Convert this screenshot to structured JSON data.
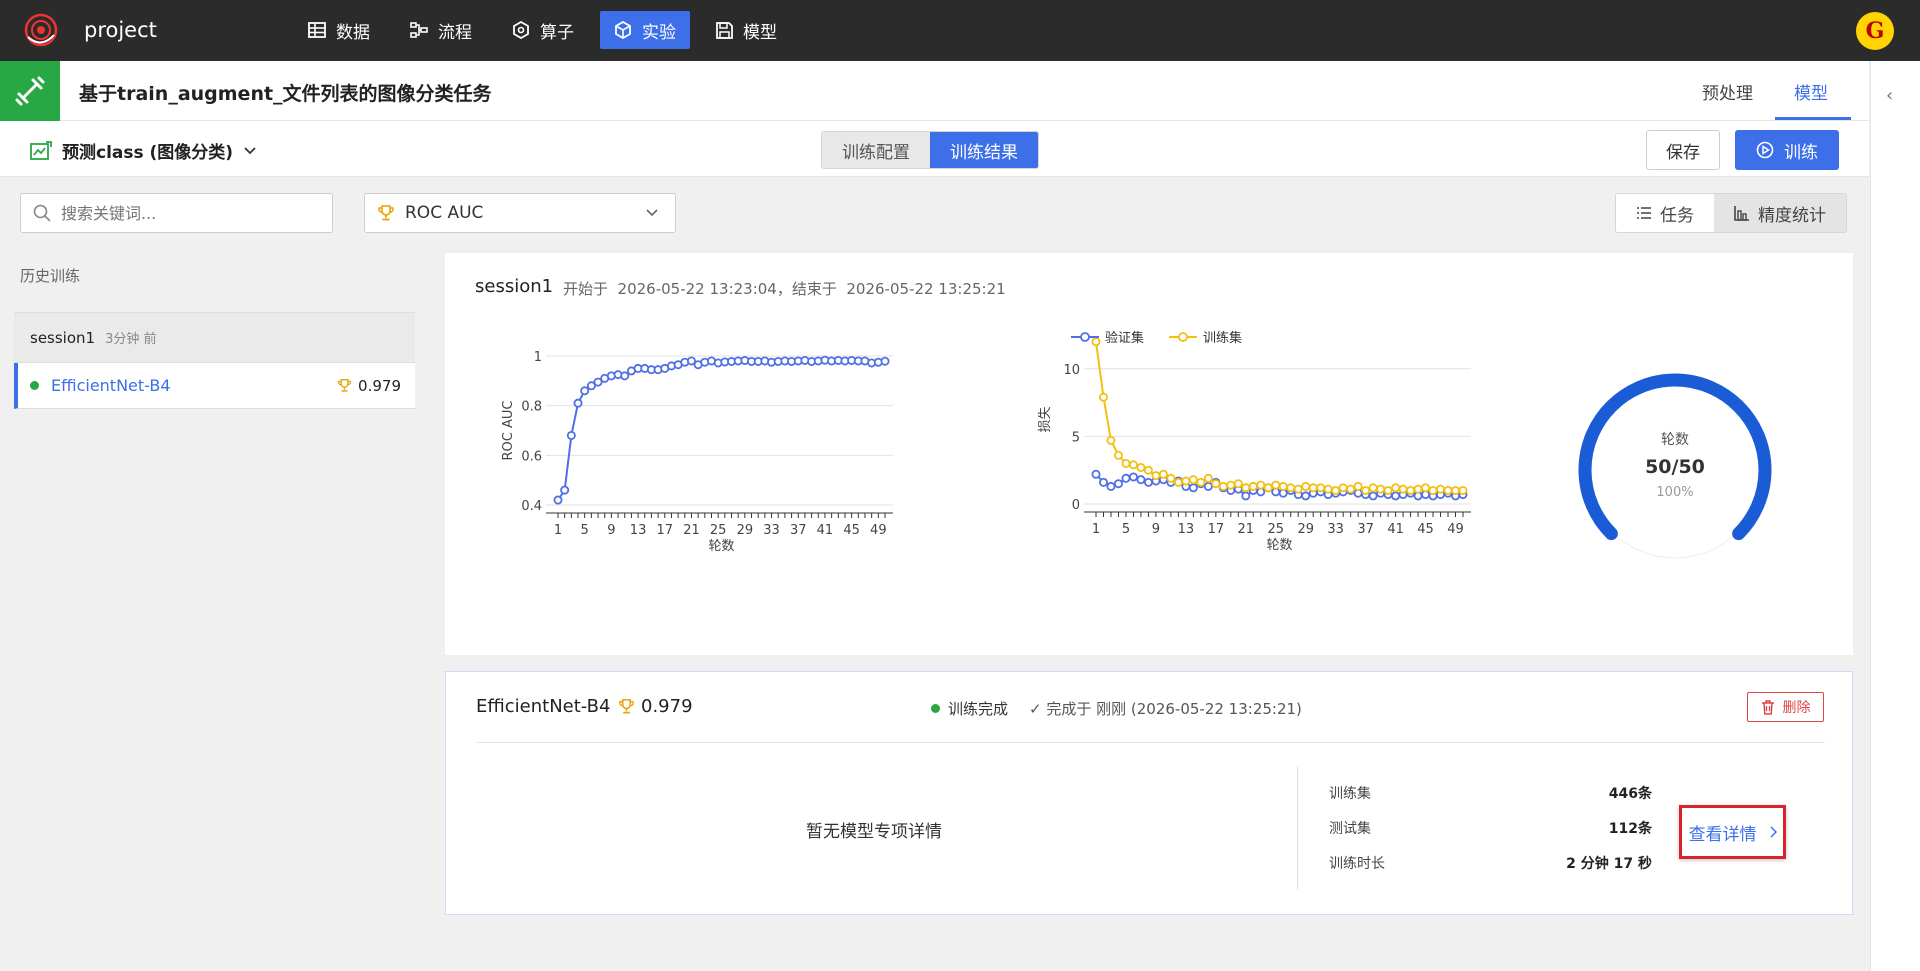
{
  "app": {
    "project_name": "project",
    "avatar_letter": "G",
    "nav": [
      {
        "label": "数据",
        "icon": "table-icon"
      },
      {
        "label": "流程",
        "icon": "flow-icon"
      },
      {
        "label": "算子",
        "icon": "operator-icon"
      },
      {
        "label": "实验",
        "icon": "cube-icon",
        "active": true
      },
      {
        "label": "模型",
        "icon": "save-icon"
      }
    ]
  },
  "header": {
    "title": "基于train_augment_文件列表的图像分类任务",
    "tabs": [
      "预处理",
      "模型"
    ],
    "active_tab": "模型"
  },
  "toolbar": {
    "prediction": "预测class (图像分类)",
    "segments": [
      "训练配置",
      "训练结果"
    ],
    "active_segment": "训练结果",
    "save_label": "保存",
    "train_label": "训练"
  },
  "filters": {
    "search_placeholder": "搜索关键词...",
    "metric": "ROC AUC",
    "view_tabs": [
      "任务",
      "精度统计"
    ],
    "active_view": "任务"
  },
  "history": {
    "label": "历史训练",
    "session_name": "session1",
    "session_time": "3分钟 前",
    "model_name": "EfficientNet-B4",
    "model_score": "0.979"
  },
  "session": {
    "name": "session1",
    "time_text": "开始于  2026-05-22 13:23:04，结束于  2026-05-22 13:25:21"
  },
  "chart_data": [
    {
      "type": "line",
      "xlabel": "轮数",
      "ylabel": "ROC AUC",
      "ylim": [
        0.4,
        1
      ],
      "yticks": [
        "0.4",
        "0.6",
        "0.8",
        "1"
      ],
      "xticks": [
        "1",
        "5",
        "9",
        "13",
        "17",
        "21",
        "25",
        "29",
        "33",
        "37",
        "41",
        "45",
        "49"
      ],
      "x": [
        1,
        2,
        3,
        4,
        5,
        6,
        7,
        8,
        9,
        10,
        11,
        12,
        13,
        14,
        15,
        16,
        17,
        18,
        19,
        20,
        21,
        22,
        23,
        24,
        25,
        26,
        27,
        28,
        29,
        30,
        31,
        32,
        33,
        34,
        35,
        36,
        37,
        38,
        39,
        40,
        41,
        42,
        43,
        44,
        45,
        46,
        47,
        48,
        49,
        50
      ],
      "series": [
        {
          "color": "#4f6fe6",
          "values": [
            0.42,
            0.46,
            0.68,
            0.81,
            0.86,
            0.88,
            0.895,
            0.91,
            0.92,
            0.925,
            0.92,
            0.94,
            0.95,
            0.95,
            0.945,
            0.945,
            0.95,
            0.96,
            0.965,
            0.975,
            0.98,
            0.965,
            0.975,
            0.98,
            0.972,
            0.976,
            0.978,
            0.98,
            0.982,
            0.978,
            0.978,
            0.98,
            0.975,
            0.978,
            0.98,
            0.978,
            0.98,
            0.982,
            0.978,
            0.98,
            0.983,
            0.98,
            0.982,
            0.98,
            0.982,
            0.98,
            0.98,
            0.972,
            0.975,
            0.979
          ]
        }
      ]
    },
    {
      "type": "line",
      "xlabel": "轮数",
      "ylabel": "损失",
      "ylim": [
        0,
        12.5
      ],
      "yticks": [
        "0",
        "5",
        "10"
      ],
      "xticks": [
        "1",
        "5",
        "9",
        "13",
        "17",
        "21",
        "25",
        "29",
        "33",
        "37",
        "41",
        "45",
        "49"
      ],
      "legend": "top",
      "x": [
        1,
        2,
        3,
        4,
        5,
        6,
        7,
        8,
        9,
        10,
        11,
        12,
        13,
        14,
        15,
        16,
        17,
        18,
        19,
        20,
        21,
        22,
        23,
        24,
        25,
        26,
        27,
        28,
        29,
        30,
        31,
        32,
        33,
        34,
        35,
        36,
        37,
        38,
        39,
        40,
        41,
        42,
        43,
        44,
        45,
        46,
        47,
        48,
        49,
        50
      ],
      "series": [
        {
          "name": "验证集",
          "color": "#4f6fe6",
          "values": [
            2.2,
            1.6,
            1.3,
            1.5,
            1.9,
            2.0,
            1.8,
            1.6,
            1.7,
            1.8,
            1.6,
            1.7,
            1.3,
            1.2,
            1.5,
            1.3,
            1.6,
            1.2,
            1.0,
            1.1,
            0.6,
            1.0,
            0.9,
            1.2,
            0.9,
            0.8,
            1.0,
            0.7,
            0.6,
            0.8,
            0.9,
            0.7,
            0.8,
            0.9,
            1.0,
            0.8,
            0.7,
            0.6,
            0.8,
            0.7,
            0.6,
            0.7,
            0.8,
            0.6,
            0.7,
            0.6,
            0.7,
            0.8,
            0.6,
            0.7
          ]
        },
        {
          "name": "训练集",
          "color": "#f2c012",
          "values": [
            12.0,
            7.9,
            4.7,
            3.6,
            3.0,
            2.9,
            2.7,
            2.5,
            2.1,
            2.2,
            1.9,
            1.6,
            1.7,
            1.8,
            1.6,
            1.9,
            1.5,
            1.3,
            1.4,
            1.5,
            1.2,
            1.3,
            1.4,
            1.2,
            1.4,
            1.3,
            1.2,
            1.1,
            1.3,
            1.2,
            1.2,
            1.1,
            1.0,
            1.2,
            1.1,
            1.3,
            1.0,
            1.2,
            1.1,
            1.0,
            1.2,
            1.1,
            1.0,
            1.1,
            1.2,
            1.0,
            1.1,
            1.0,
            1.0,
            1.0
          ]
        }
      ]
    }
  ],
  "gauge": {
    "label": "轮数",
    "value": "50/50",
    "percent_text": "100%",
    "fraction": 1.0
  },
  "result_card": {
    "model_name": "EfficientNet-B4",
    "score": "0.979",
    "status": "训练完成",
    "done_text": "完成于 刚刚 (2026-05-22 13:25:21)",
    "delete_label": "删除",
    "no_detail": "暂无模型专项详情",
    "stats": [
      {
        "label": "训练集",
        "value": "446条"
      },
      {
        "label": "测试集",
        "value": "112条"
      },
      {
        "label": "训练时长",
        "value": "2 分钟 17 秒"
      }
    ],
    "detail_label": "查看详情"
  },
  "colors": {
    "accent": "#3d6fe8",
    "success": "#27a844",
    "danger": "#e04545",
    "train_series": "#f2c012",
    "val_series": "#4f6fe6",
    "gauge": "#1a5cd6"
  }
}
